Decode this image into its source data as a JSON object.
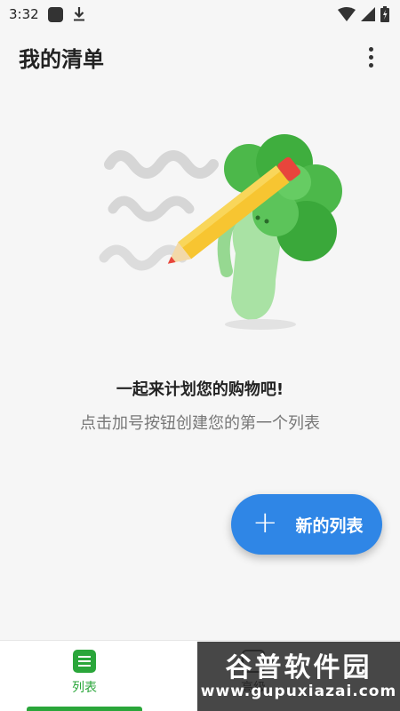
{
  "status_bar": {
    "time": "3:32",
    "icons": [
      "notification-square-icon",
      "download-icon",
      "wifi-icon",
      "signal-icon",
      "battery-icon"
    ]
  },
  "app_bar": {
    "title": "我的清单",
    "overflow_icon": "more-vert-icon"
  },
  "empty_state": {
    "illustration": "broccoli-with-pencil",
    "title": "一起来计划您的购物吧!",
    "subtitle": "点击加号按钮创建您的第一个列表"
  },
  "fab": {
    "label": "新的列表",
    "icon": "plus-icon",
    "color": "#2f86e6"
  },
  "bottom_nav": {
    "items": [
      {
        "label": "列表",
        "icon": "list-icon",
        "active": true
      },
      {
        "label": "高级",
        "icon": "advanced-icon",
        "active": false
      }
    ],
    "active_color": "#2aa63a"
  },
  "watermark": {
    "title": "谷普软件园",
    "url": "www.gupuxiazai.com"
  }
}
